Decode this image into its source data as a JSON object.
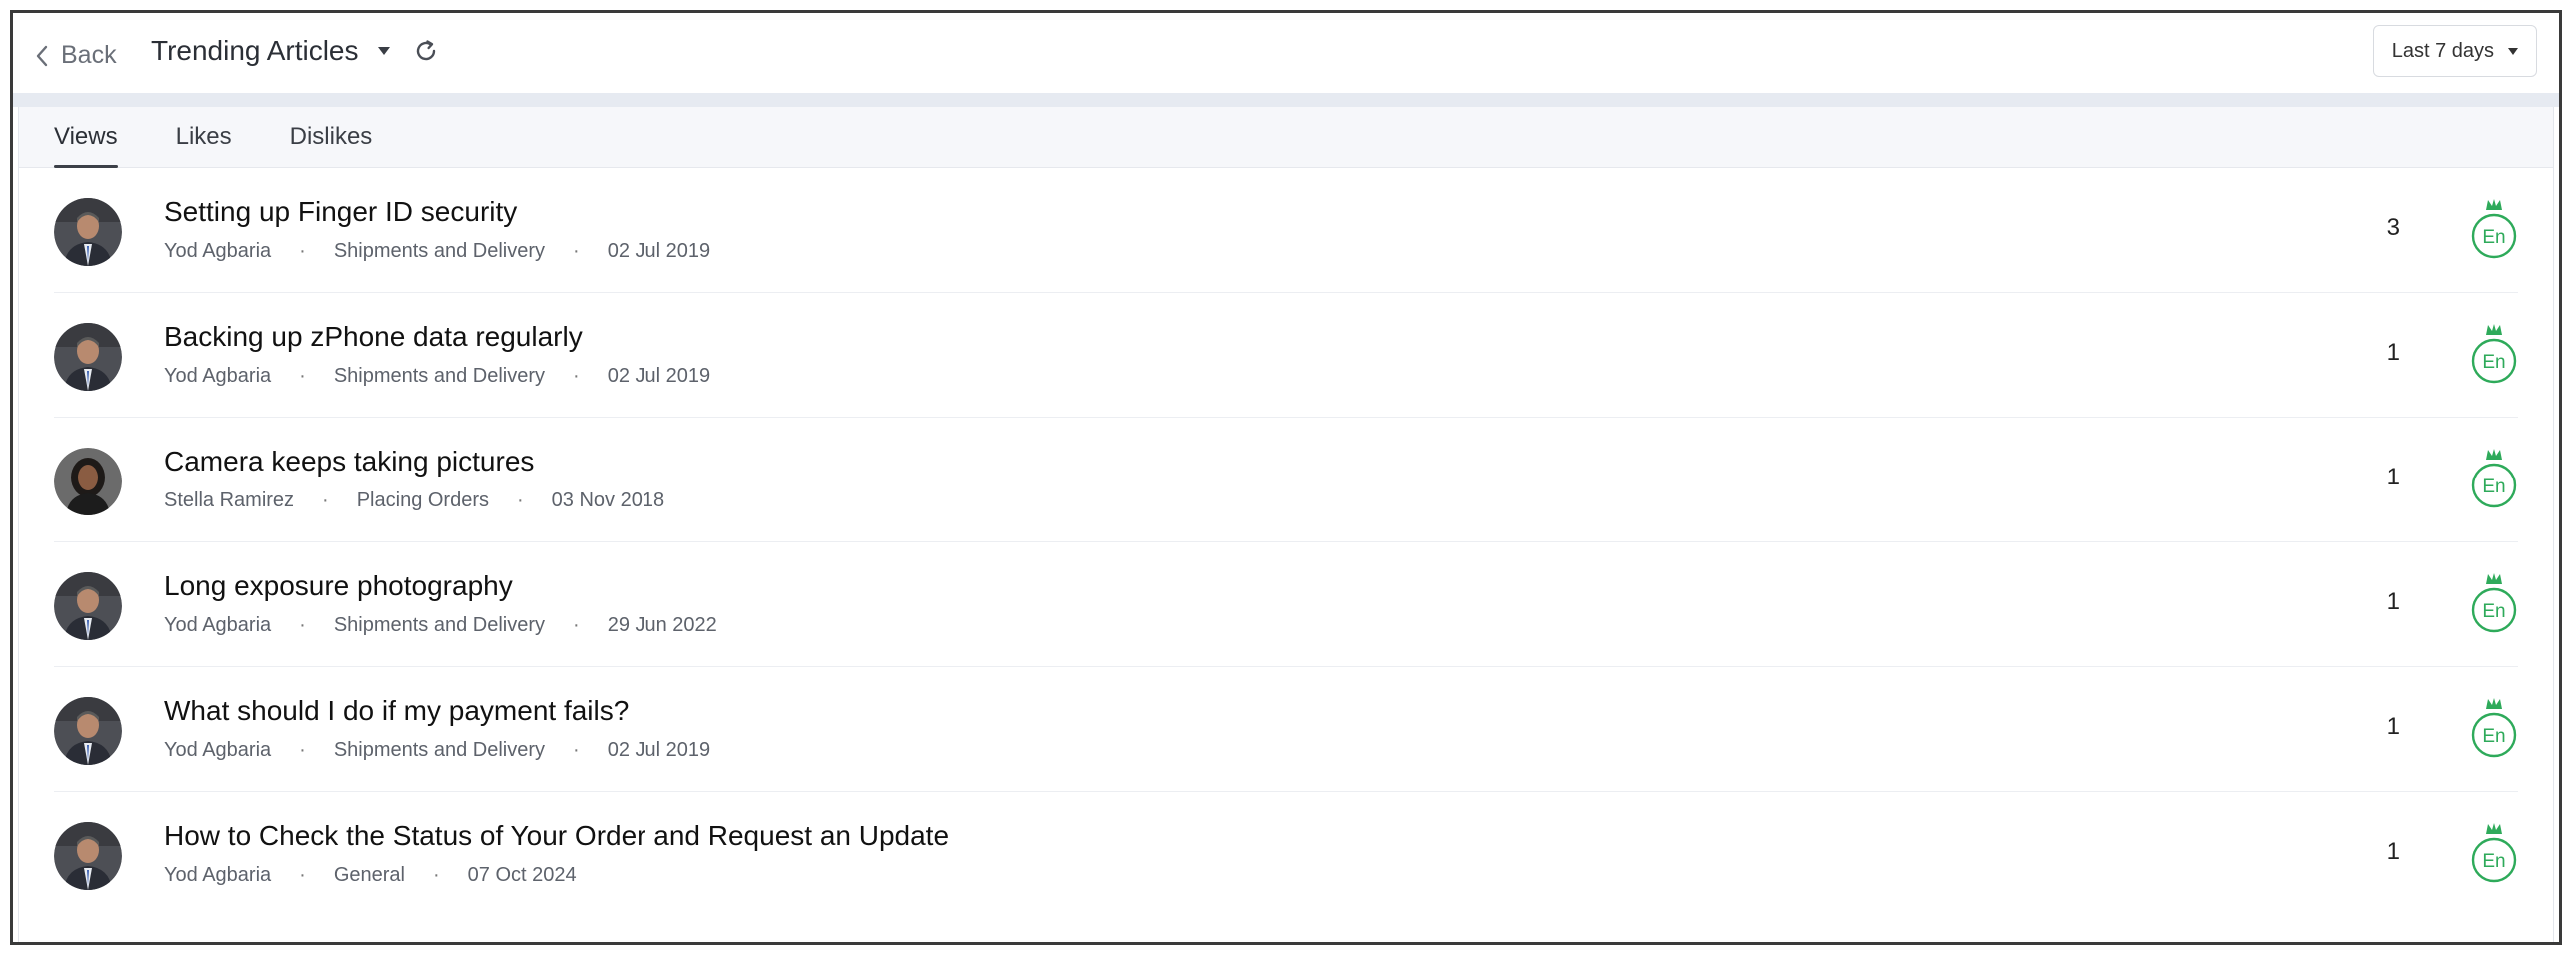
{
  "header": {
    "back_label": "Back",
    "title": "Trending Articles",
    "range_label": "Last 7 days"
  },
  "tabs": [
    {
      "label": "Views",
      "active": true
    },
    {
      "label": "Likes",
      "active": false
    },
    {
      "label": "Dislikes",
      "active": false
    }
  ],
  "articles": [
    {
      "title": "Setting up Finger ID security",
      "author": "Yod Agbaria",
      "category": "Shipments and Delivery",
      "date": "02 Jul 2019",
      "count": "3",
      "lang": "En",
      "avatar": "male"
    },
    {
      "title": "Backing up zPhone data regularly",
      "author": "Yod Agbaria",
      "category": "Shipments and Delivery",
      "date": "02 Jul 2019",
      "count": "1",
      "lang": "En",
      "avatar": "male"
    },
    {
      "title": "Camera keeps taking pictures",
      "author": "Stella Ramirez",
      "category": "Placing Orders",
      "date": "03 Nov 2018",
      "count": "1",
      "lang": "En",
      "avatar": "female"
    },
    {
      "title": "Long exposure photography",
      "author": "Yod Agbaria",
      "category": "Shipments and Delivery",
      "date": "29 Jun 2022",
      "count": "1",
      "lang": "En",
      "avatar": "male"
    },
    {
      "title": "What should I do if my payment fails?",
      "author": "Yod Agbaria",
      "category": "Shipments and Delivery",
      "date": "02 Jul 2019",
      "count": "1",
      "lang": "En",
      "avatar": "male"
    },
    {
      "title": "How to Check the Status of Your Order and Request an Update",
      "author": "Yod Agbaria",
      "category": "General",
      "date": "07 Oct 2024",
      "count": "1",
      "lang": "En",
      "avatar": "male"
    }
  ],
  "colors": {
    "lang_badge": "#2eaa5a",
    "band": "#e6eaf1"
  }
}
